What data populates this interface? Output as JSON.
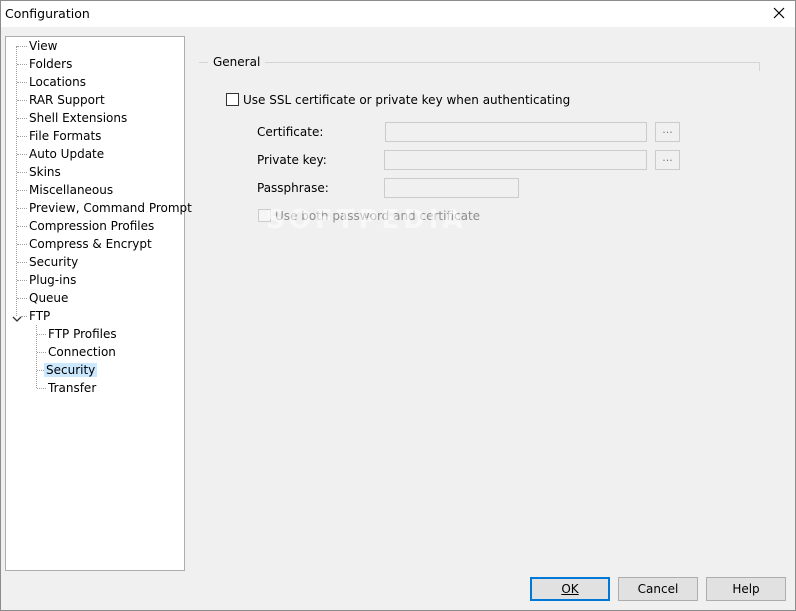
{
  "window": {
    "title": "Configuration",
    "close_icon": "close-icon"
  },
  "tree": {
    "items": [
      {
        "label": "View"
      },
      {
        "label": "Folders"
      },
      {
        "label": "Locations"
      },
      {
        "label": "RAR Support"
      },
      {
        "label": "Shell Extensions"
      },
      {
        "label": "File Formats"
      },
      {
        "label": "Auto Update"
      },
      {
        "label": "Skins"
      },
      {
        "label": "Miscellaneous"
      },
      {
        "label": "Preview, Command Prompt"
      },
      {
        "label": "Compression Profiles"
      },
      {
        "label": "Compress & Encrypt"
      },
      {
        "label": "Security"
      },
      {
        "label": "Plug-ins"
      },
      {
        "label": "Queue"
      },
      {
        "label": "FTP",
        "expanded": true,
        "children": [
          {
            "label": "FTP Profiles"
          },
          {
            "label": "Connection"
          },
          {
            "label": "Security",
            "selected": true
          },
          {
            "label": "Transfer"
          }
        ]
      }
    ]
  },
  "general": {
    "group_label": "General",
    "ssl_checkbox_label": "Use SSL certificate or private key when authenticating",
    "ssl_checked": false,
    "certificate_label": "Certificate:",
    "certificate_value": "",
    "private_key_label": "Private key:",
    "private_key_value": "",
    "passphrase_label": "Passphrase:",
    "passphrase_value": "",
    "browse_label": "...",
    "both_checkbox_label": "Use both password and certificate",
    "both_checked": false
  },
  "buttons": {
    "ok": "OK",
    "cancel": "Cancel",
    "help": "Help"
  },
  "watermark": "SOFTPEDIA",
  "colors": {
    "selection": "#cce8ff",
    "default_button_border": "#0078d7",
    "disabled_text": "#8d8d8d"
  }
}
